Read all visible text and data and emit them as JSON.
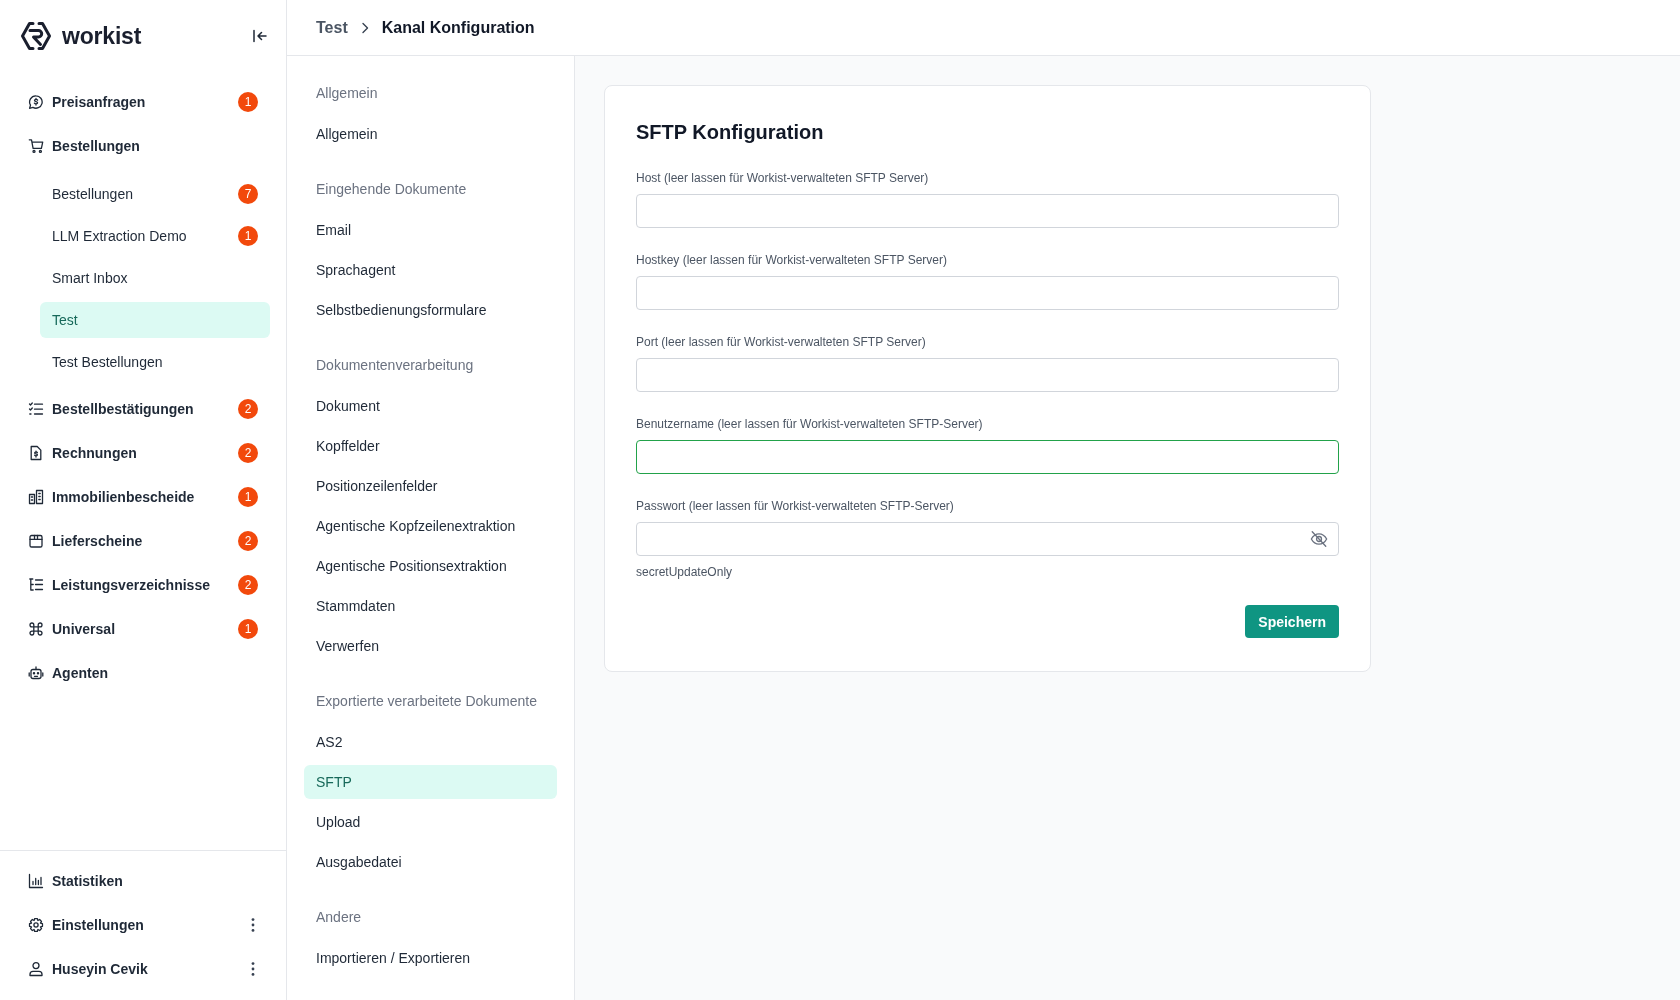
{
  "sidebar": {
    "brand": "workist",
    "nav": [
      {
        "label": "Preisanfragen",
        "badge": "1",
        "selected": false
      },
      {
        "label": "Bestellungen",
        "selected": false,
        "children": [
          {
            "label": "Bestellungen",
            "badge": "7",
            "selected": false
          },
          {
            "label": "LLM Extraction Demo",
            "badge": "1",
            "selected": false
          },
          {
            "label": "Smart Inbox",
            "selected": false
          },
          {
            "label": "Test",
            "selected": true
          },
          {
            "label": "Test Bestellungen",
            "selected": false
          }
        ]
      },
      {
        "label": "Bestellbestätigungen",
        "badge": "2",
        "selected": false
      },
      {
        "label": "Rechnungen",
        "badge": "2",
        "selected": false
      },
      {
        "label": "Immobilienbescheide",
        "badge": "1",
        "selected": false
      },
      {
        "label": "Lieferscheine",
        "badge": "2",
        "selected": false
      },
      {
        "label": "Leistungsverzeichnisse",
        "badge": "2",
        "selected": false
      },
      {
        "label": "Universal",
        "badge": "1",
        "selected": false
      },
      {
        "label": "Agenten",
        "selected": false
      }
    ],
    "footer": [
      {
        "label": "Statistiken",
        "menu": false,
        "selected": false
      },
      {
        "label": "Einstellungen",
        "menu": true,
        "selected": false
      },
      {
        "label": "Huseyin Cevik",
        "menu": true,
        "selected": false
      }
    ]
  },
  "breadcrumb": [
    "Test",
    "Kanal Konfiguration"
  ],
  "settings_nav": [
    {
      "heading": "Allgemein",
      "items": [
        {
          "label": "Allgemein",
          "selected": false
        }
      ]
    },
    {
      "heading": "Eingehende Dokumente",
      "items": [
        {
          "label": "Email",
          "selected": false
        },
        {
          "label": "Sprachagent",
          "selected": false
        },
        {
          "label": "Selbstbedienungsformulare",
          "selected": false
        }
      ]
    },
    {
      "heading": "Dokumentenverarbeitung",
      "items": [
        {
          "label": "Dokument",
          "selected": false
        },
        {
          "label": "Kopffelder",
          "selected": false
        },
        {
          "label": "Positionzeilenfelder",
          "selected": false
        },
        {
          "label": "Agentische Kopfzeilenextraktion",
          "selected": false
        },
        {
          "label": "Agentische Positionsextraktion",
          "selected": false
        },
        {
          "label": "Stammdaten",
          "selected": false
        },
        {
          "label": "Verwerfen",
          "selected": false
        }
      ]
    },
    {
      "heading": "Exportierte verarbeitete Dokumente",
      "items": [
        {
          "label": "AS2",
          "selected": false
        },
        {
          "label": "SFTP",
          "selected": true
        },
        {
          "label": "Upload",
          "selected": false
        },
        {
          "label": "Ausgabedatei",
          "selected": false
        }
      ]
    },
    {
      "heading": "Andere",
      "items": [
        {
          "label": "Importieren / Exportieren",
          "selected": false
        }
      ]
    }
  ],
  "form": {
    "title": "SFTP Konfiguration",
    "fields": [
      {
        "kind": "text",
        "label": "Host (leer lassen für Workist-verwalteten SFTP Server)",
        "focused": false
      },
      {
        "kind": "text",
        "label": "Hostkey (leer lassen für Workist-verwalteten SFTP Server)",
        "focused": false
      },
      {
        "kind": "text",
        "label": "Port (leer lassen für Workist-verwalteten SFTP Server)",
        "focused": false
      },
      {
        "kind": "text",
        "label": "Benutzername (leer lassen für Workist-verwalteten SFTP-Server)",
        "focused": true
      },
      {
        "kind": "password",
        "label": "Passwort (leer lassen für Workist-verwalteten SFTP-Server)",
        "focused": false,
        "hint": "secretUpdateOnly"
      }
    ],
    "submit": "Speichern"
  }
}
